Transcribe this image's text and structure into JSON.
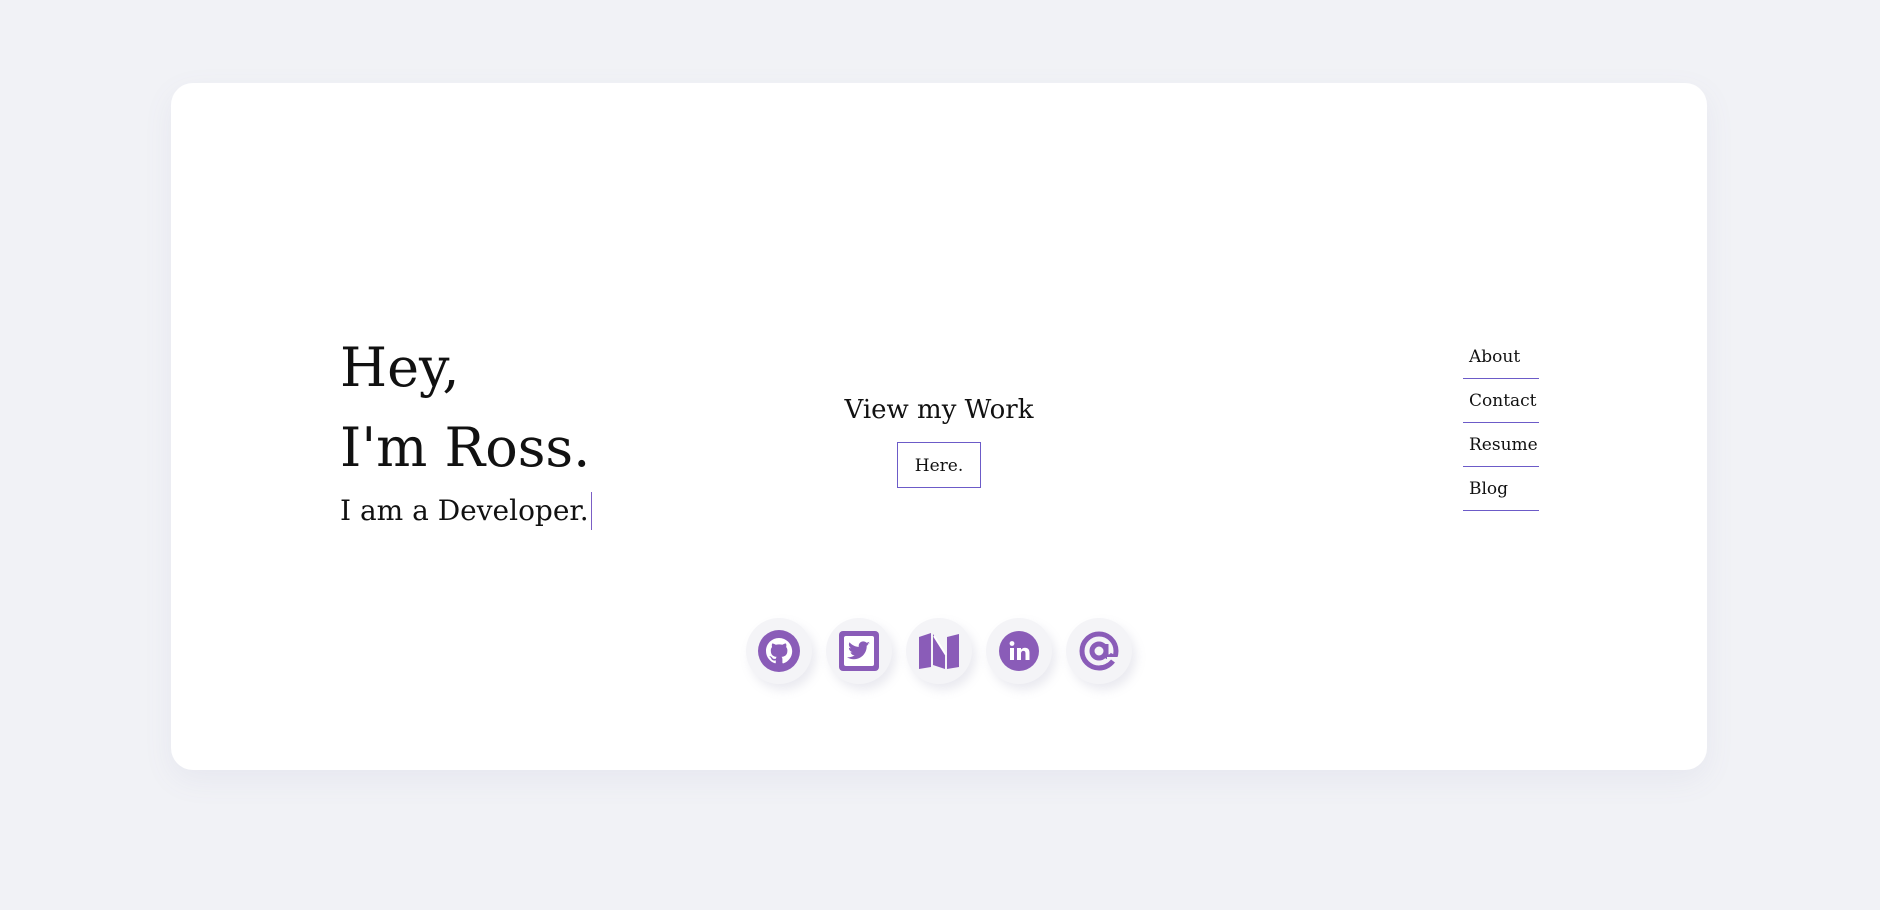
{
  "hero": {
    "greeting": "Hey,",
    "name_line": "I'm Ross.",
    "role_line": "I am a Developer."
  },
  "work": {
    "title": "View my Work",
    "button_label": "Here."
  },
  "nav": {
    "items": [
      {
        "label": "About"
      },
      {
        "label": "Contact"
      },
      {
        "label": "Resume"
      },
      {
        "label": "Blog"
      }
    ]
  },
  "socials": [
    {
      "icon": "github-icon"
    },
    {
      "icon": "twitter-icon"
    },
    {
      "icon": "medium-icon"
    },
    {
      "icon": "linkedin-icon"
    },
    {
      "icon": "email-at-icon"
    }
  ],
  "colors": {
    "accent": "#8a5cb8",
    "background": "#f1f2f6",
    "card": "#ffffff",
    "underline": "#6c5bc8"
  }
}
